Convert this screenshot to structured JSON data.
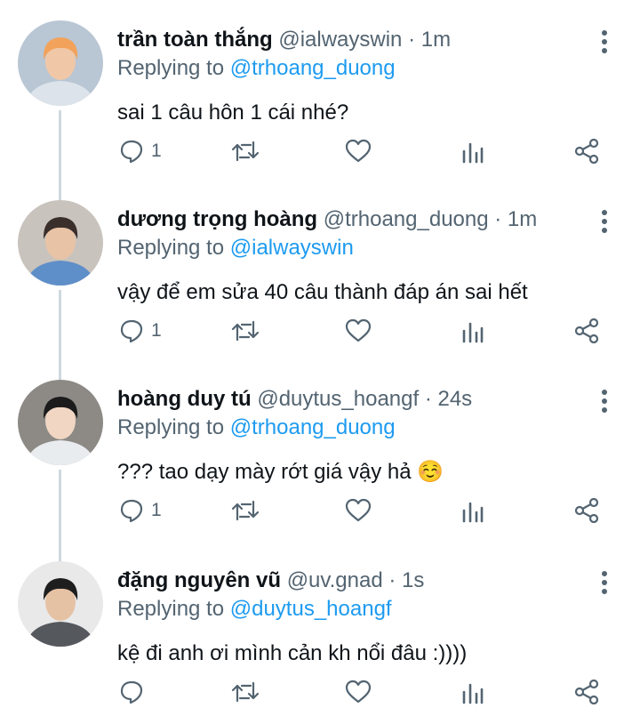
{
  "tweets": [
    {
      "name": "trần toàn thắng",
      "handle": "@ialwayswin",
      "time": "1m",
      "replying_prefix": "Replying to",
      "replying_to": "@trhoang_duong",
      "text": "sai 1 câu hôn 1 cái nhé?",
      "reply_count": "1",
      "avatar_colors": {
        "bg": "#b9c6d4",
        "hair": "#f2a25a",
        "skin": "#f0c8a8",
        "shirt": "#dde3ea"
      }
    },
    {
      "name": "dương trọng hoàng",
      "handle": "@trhoang_duong",
      "time": "1m",
      "replying_prefix": "Replying to",
      "replying_to": "@ialwayswin",
      "text": "vậy để em sửa 40 câu thành đáp án sai hết",
      "reply_count": "1",
      "avatar_colors": {
        "bg": "#c9c3bd",
        "hair": "#3a2f2a",
        "skin": "#e8c3a6",
        "shirt": "#5f8fc9"
      }
    },
    {
      "name": "hoàng duy tú",
      "handle": "@duytus_hoangf",
      "time": "24s",
      "replying_prefix": "Replying to",
      "replying_to": "@trhoang_duong",
      "text": "??? tao dạy mày rớt giá vậy hả ☺️",
      "reply_count": "1",
      "avatar_colors": {
        "bg": "#8d8a86",
        "hair": "#1c1b1b",
        "skin": "#f1d6c4",
        "shirt": "#e9ecef"
      }
    },
    {
      "name": "đặng nguyên vũ",
      "handle": "@uv.gnad",
      "time": "1s",
      "replying_prefix": "Replying to",
      "replying_to": "@duytus_hoangf",
      "text": "kệ đi anh ơi mình cản kh nổi đâu :))))",
      "reply_count": "",
      "avatar_colors": {
        "bg": "#e9e9ea",
        "hair": "#1e1e1e",
        "skin": "#e6c2a4",
        "shirt": "#55585d"
      }
    }
  ],
  "separator": " · ",
  "ui": {
    "accent": "#1d9bf0",
    "muted": "#536471",
    "text": "#0f1419"
  }
}
